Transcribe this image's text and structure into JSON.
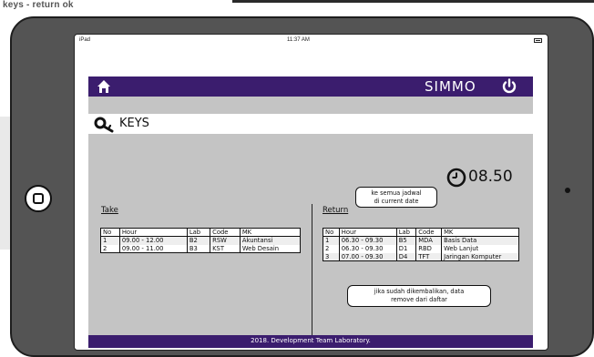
{
  "caption": "keys - return ok",
  "status_bar": {
    "carrier": "iPad",
    "time": "11:37 AM"
  },
  "header": {
    "app_title": "SIMMO"
  },
  "page": {
    "title": "KEYS"
  },
  "clock": {
    "time": "08.50"
  },
  "callouts": {
    "time_note_line1": "ke semua jadwal",
    "time_note_line2": "di current date",
    "return_note_line1": "jika sudah dikembalikan, data",
    "return_note_line2": "remove dari daftar"
  },
  "take": {
    "label": "Take",
    "columns": [
      "No",
      "Hour",
      "Lab",
      "Code",
      "MK"
    ],
    "rows": [
      [
        "1",
        "09.00 - 12.00",
        "B2",
        "RSW",
        "Akuntansi"
      ],
      [
        "2",
        "09.00 - 11.00",
        "B3",
        "KST",
        "Web Desain"
      ]
    ]
  },
  "return": {
    "label": "Return",
    "columns": [
      "No",
      "Hour",
      "Lab",
      "Code",
      "MK"
    ],
    "rows": [
      [
        "1",
        "06.30 - 09.30",
        "B5",
        "MDA",
        "Basis Data"
      ],
      [
        "2",
        "06.30 - 09.30",
        "D1",
        "RBD",
        "Web Lanjut"
      ],
      [
        "3",
        "07.00 - 09.30",
        "D4",
        "TFT",
        "Jaringan Komputer"
      ]
    ]
  },
  "footer": {
    "text": "2018. Development Team Laboratory."
  },
  "icons": {
    "home": "home-icon",
    "power": "power-icon",
    "key": "key-icon",
    "clock": "clock-icon"
  },
  "colors": {
    "brand": "#3b1d6e",
    "content_bg": "#c4c4c4",
    "device_body": "#545454"
  }
}
